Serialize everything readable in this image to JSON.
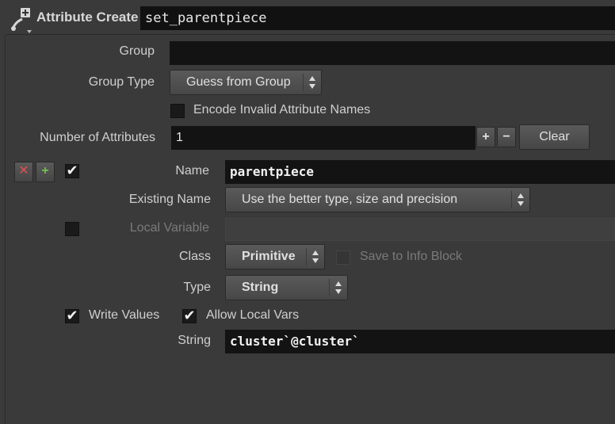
{
  "header": {
    "node_type_label": "Attribute Create",
    "node_name": "set_parentpiece",
    "icon": "attribute-create-node-icon"
  },
  "group": {
    "label": "Group",
    "value": ""
  },
  "group_type": {
    "label": "Group Type",
    "value": "Guess from Group"
  },
  "encode_invalid": {
    "label": "Encode Invalid Attribute Names",
    "checked": false
  },
  "num_attributes": {
    "label": "Number of Attributes",
    "value": "1",
    "add_label": "+",
    "remove_label": "−",
    "clear_label": "Clear"
  },
  "attribute": {
    "enabled": true,
    "name": {
      "label": "Name",
      "value": "parentpiece"
    },
    "existing_name": {
      "label": "Existing Name",
      "value": "Use the better type, size and precision"
    },
    "local_variable": {
      "label": "Local Variable",
      "value": "",
      "checked": false
    },
    "class": {
      "label": "Class",
      "value": "Primitive"
    },
    "save_to_info": {
      "label": "Save to Info Block",
      "checked": false
    },
    "type": {
      "label": "Type",
      "value": "String"
    },
    "write_values": {
      "label": "Write Values",
      "checked": true
    },
    "allow_local_vars": {
      "label": "Allow Local Vars",
      "checked": true
    },
    "string": {
      "label": "String",
      "value": "cluster`@cluster`"
    }
  },
  "colors": {
    "background": "#3a3a3a",
    "field": "#131313",
    "remove_icon": "#e05050",
    "insert_icon": "#6fc24a"
  }
}
